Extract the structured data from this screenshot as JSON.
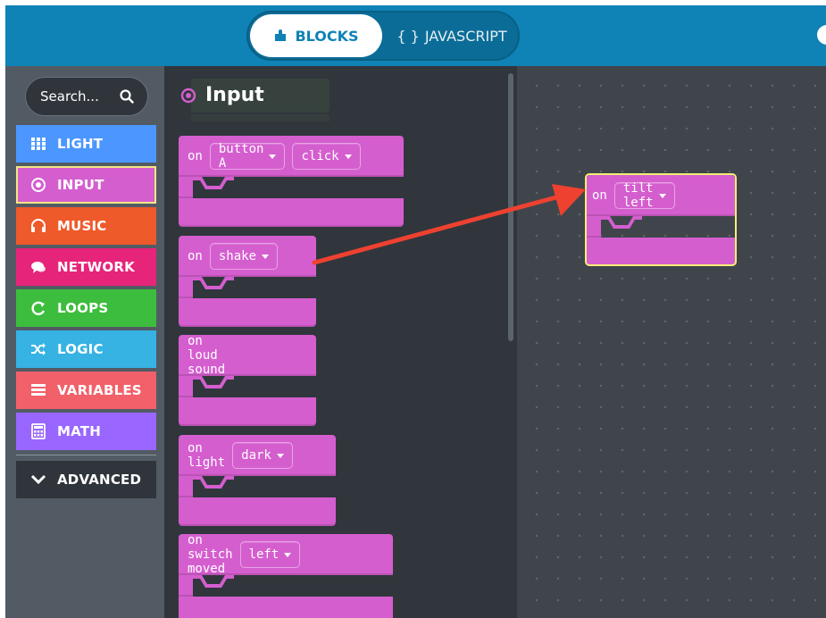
{
  "header": {
    "tabs": [
      {
        "label": "BLOCKS",
        "icon": "puzzle-icon",
        "selected": true
      },
      {
        "label": "JAVASCRIPT",
        "icon": "braces-icon",
        "selected": false
      }
    ],
    "braces": "{ }"
  },
  "toolbox": {
    "search": {
      "placeholder": "Search...",
      "icon": "search-icon"
    },
    "categories": [
      {
        "label": "LIGHT",
        "icon": "grid-icon",
        "color": "#4c97ff"
      },
      {
        "label": "INPUT",
        "icon": "target-icon",
        "color": "#d55ecf",
        "selected": true
      },
      {
        "label": "MUSIC",
        "icon": "headphones-icon",
        "color": "#ee5a2a"
      },
      {
        "label": "NETWORK",
        "icon": "chat-icon",
        "color": "#e6247a"
      },
      {
        "label": "LOOPS",
        "icon": "refresh-icon",
        "color": "#3dbd3d"
      },
      {
        "label": "LOGIC",
        "icon": "shuffle-icon",
        "color": "#36b2e3"
      },
      {
        "label": "VARIABLES",
        "icon": "list-icon",
        "color": "#f2606a"
      },
      {
        "label": "MATH",
        "icon": "calculator-icon",
        "color": "#9966ff"
      },
      {
        "label": "ADVANCED",
        "icon": "chevron-down-icon",
        "color": "#2f353b"
      }
    ]
  },
  "flyout": {
    "title": "Input",
    "title_icon": "target-icon",
    "blocks": [
      {
        "prefix": "on",
        "dropdowns": [
          "button A",
          "click"
        ]
      },
      {
        "prefix": "on",
        "dropdowns": [
          "shake"
        ]
      },
      {
        "prefix": "on loud sound",
        "dropdowns": []
      },
      {
        "prefix": "on light",
        "dropdowns": [
          "dark"
        ]
      },
      {
        "prefix": "on switch moved",
        "dropdowns": [
          "left"
        ]
      }
    ]
  },
  "workspace": {
    "block": {
      "prefix": "on",
      "dropdown": "tilt left"
    }
  },
  "colors": {
    "block": "#d55ecf",
    "header": "#0f82b6",
    "arrow": "#ee4130",
    "selection_outline": "#f7ef78"
  }
}
